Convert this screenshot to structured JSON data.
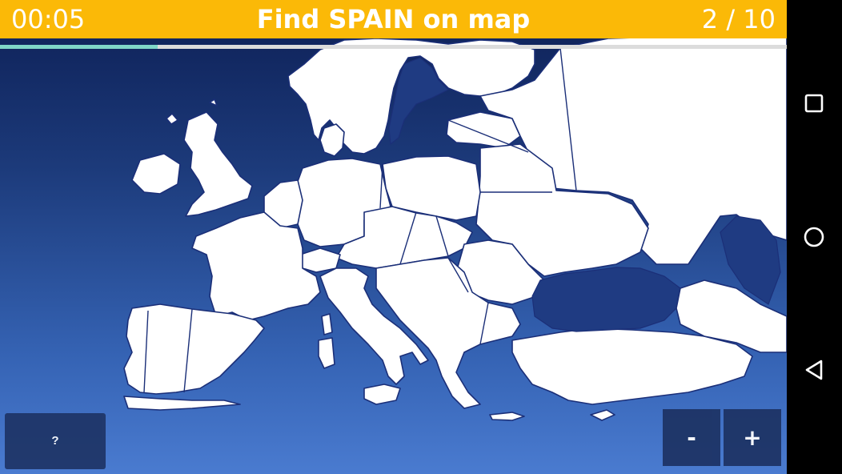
{
  "header": {
    "timer": "00:05",
    "title": "Find SPAIN on map",
    "counter": "2 / 10"
  },
  "progress": {
    "fraction": 0.2,
    "color": "#7fd6c8"
  },
  "colors": {
    "header_bg": "#fbb907",
    "land": "#ffffff",
    "borders": "#1b2f78",
    "button_bg": "#1e3466"
  },
  "controls": {
    "hint_label": "?",
    "zoom_out_label": "-",
    "zoom_in_label": "+"
  },
  "navbar": {
    "icons": [
      "recent-apps-icon",
      "home-icon",
      "back-icon"
    ]
  }
}
